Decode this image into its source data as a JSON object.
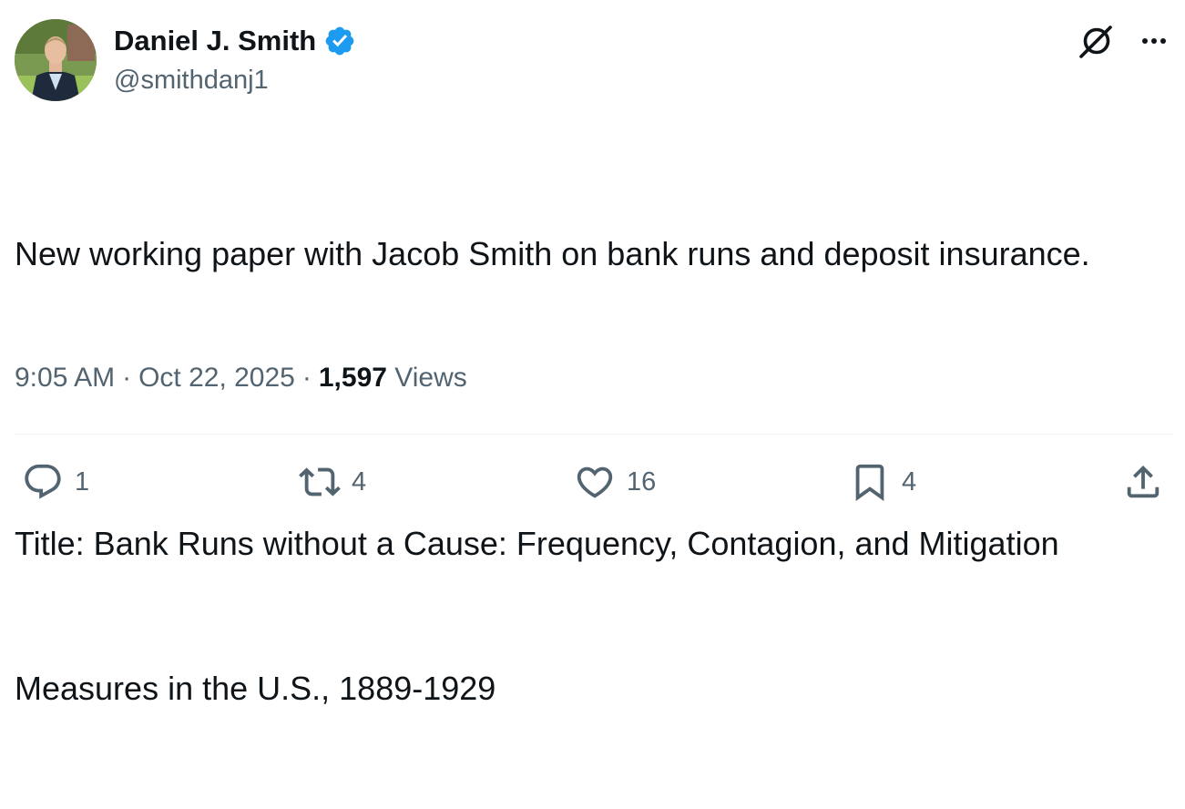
{
  "author": {
    "display_name": "Daniel J. Smith",
    "handle": "@smithdanj1",
    "verified": true
  },
  "tweet": {
    "lines": [
      "New working paper with Jacob Smith on bank runs and deposit insurance.",
      "",
      "Title: Bank Runs without a Cause: Frequency, Contagion, and Mitigation",
      "Measures in the U.S., 1889-1929"
    ]
  },
  "meta": {
    "time": "9:05 AM",
    "separator": "·",
    "date": "Oct 22, 2025",
    "views_count": "1,597",
    "views_label": "Views"
  },
  "actions": {
    "replies": "1",
    "retweets": "4",
    "likes": "16",
    "bookmarks": "4"
  },
  "icons": {
    "verified": "verified-badge-icon",
    "grok": "grok-icon",
    "more": "more-icon",
    "reply": "reply-icon",
    "retweet": "retweet-icon",
    "like": "heart-icon",
    "bookmark": "bookmark-icon",
    "share": "share-icon"
  },
  "colors": {
    "text_primary": "#0f1419",
    "text_secondary": "#536471",
    "verified_blue": "#1d9bf0",
    "divider": "#eff3f4"
  }
}
